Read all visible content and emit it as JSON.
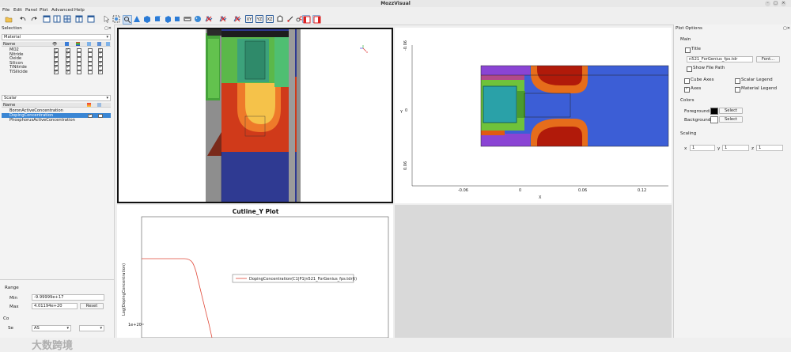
{
  "window": {
    "title": "MozzVisual"
  },
  "menu": [
    "File",
    "Edit",
    "Panel",
    "Plot",
    "Advanced",
    "Help"
  ],
  "selection": {
    "title": "Selection",
    "material_combo": "Material",
    "material_header": "Name",
    "materials": [
      "MO2",
      "Nitride",
      "Oxide",
      "Silicon",
      "TiNitride",
      "TiSilicide"
    ],
    "scalar_combo": "Scalar",
    "scalar_header": "Name",
    "scalars": [
      "BoronActiveConcentration",
      "DopingConcentration",
      "PhosphorusActiveConcentration"
    ],
    "selected_scalar_index": 1
  },
  "range": {
    "title": "Range",
    "min_label": "Min",
    "min_value": "-9.99999e+17",
    "max_label": "Max",
    "max_value": "4.01194e+20",
    "reset_label": "Reset"
  },
  "bottom_left": {
    "label1": "Co",
    "label2": "Se",
    "value": "AS"
  },
  "view_2d": {
    "y_label": "Y",
    "x_label": "X",
    "x_ticks": [
      "-0.06",
      "0",
      "0.06",
      "0.12"
    ],
    "y_ticks": [
      "-0.06",
      "0",
      "0.06"
    ]
  },
  "cutline": {
    "title": "Cutline_Y Plot",
    "y_label": "Log(DopingConcentration)",
    "y_tick": "1e+20",
    "legend": "DopingConcentration(C1|P1|n521_ForGenius_fps.tdr|t)"
  },
  "plot_options": {
    "title": "Plot Options",
    "main_label": "Main",
    "title_checkbox": "Title",
    "file_value": "n521_ForGenius_fps.tdr",
    "font_button": "Font...",
    "show_file_path": "Show File Path",
    "cube_axes": "Cube Axes",
    "scalar_legend": "Scalar Legend",
    "axes": "Axes",
    "material_legend": "Material Legend",
    "colors_label": "Colors",
    "foreground_label": "Foreground:",
    "background_label": "Background:",
    "select_label": "Select",
    "foreground_color": "#000000",
    "background_color": "#ffffff",
    "scaling_label": "Scaling",
    "scale_x_label": "x",
    "scale_x": "1",
    "scale_y_label": "y",
    "scale_y": "1",
    "scale_z_label": "z",
    "scale_z": "1"
  },
  "watermark": "大数跨境"
}
